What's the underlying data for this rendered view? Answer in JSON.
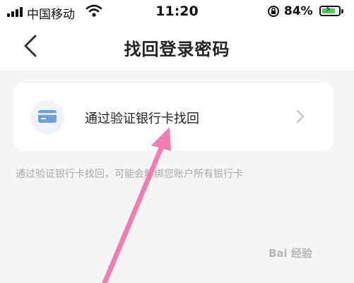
{
  "status_bar": {
    "carrier": "中国移动",
    "time": "11:20",
    "battery": "84%",
    "battery_level": 0.84
  },
  "nav": {
    "title": "找回登录密码",
    "back_icon": "chevron-left-icon"
  },
  "options": [
    {
      "label": "通过验证银行卡找回",
      "icon": "bank-card-icon"
    }
  ],
  "hint": "通过验证银行卡找回，可能会解绑您账户所有银行卡",
  "watermark": "Bai 经验",
  "colors": {
    "background": "#f5f5f6",
    "card": "#ffffff",
    "icon_accent": "#6f9fd8",
    "annotation_arrow": "#f07fb0",
    "battery_fill": "#5bc55b"
  }
}
